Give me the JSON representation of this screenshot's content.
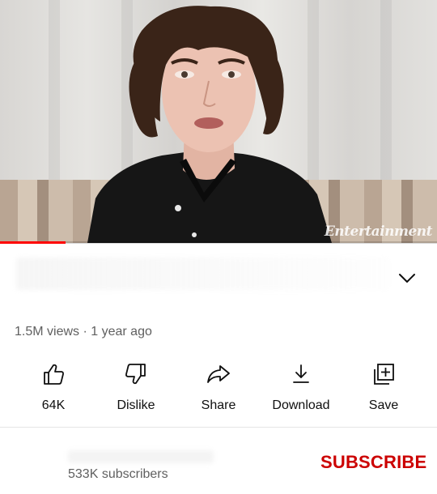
{
  "video": {
    "watermark": "Entertainment",
    "progress_fraction": 0.15
  },
  "meta": {
    "views": "1.5M views",
    "separator": "·",
    "age": "1 year ago"
  },
  "actions": [
    {
      "label": "64K",
      "icon": "thumbs-up-icon"
    },
    {
      "label": "Dislike",
      "icon": "thumbs-down-icon"
    },
    {
      "label": "Share",
      "icon": "share-icon"
    },
    {
      "label": "Download",
      "icon": "download-icon"
    },
    {
      "label": "Save",
      "icon": "save-to-playlist-icon"
    }
  ],
  "channel": {
    "subscribers": "533K subscribers",
    "subscribe_label": "SUBSCRIBE"
  },
  "colors": {
    "accent": "#ff0000",
    "subscribe": "#cc0000",
    "secondary_text": "#606060"
  }
}
